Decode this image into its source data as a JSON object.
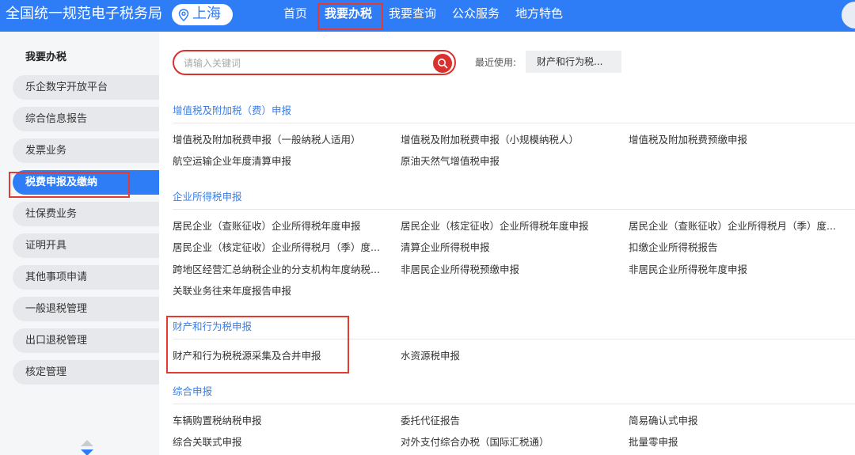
{
  "header": {
    "brand": "全国统一规范电子税务局",
    "region": "上海",
    "nav": [
      "首页",
      "我要办税",
      "我要查询",
      "公众服务",
      "地方特色"
    ]
  },
  "sidebar": {
    "title": "我要办税",
    "items": [
      "乐企数字开放平台",
      "综合信息报告",
      "发票业务",
      "税费申报及缴纳",
      "社保费业务",
      "证明开具",
      "其他事项申请",
      "一般退税管理",
      "出口退税管理",
      "核定管理"
    ],
    "active": "税费申报及缴纳"
  },
  "search": {
    "placeholder": "请输入关键词",
    "recent_label": "最近使用:",
    "recent_item": "财产和行为税..."
  },
  "sections": [
    {
      "title": "增值税及附加税（费）申报",
      "items": [
        "增值税及附加税费申报（一般纳税人适用）",
        "增值税及附加税费申报（小规模纳税人）",
        "增值税及附加税费预缴申报",
        "航空运输企业年度清算申报",
        "原油天然气增值税申报"
      ]
    },
    {
      "title": "企业所得税申报",
      "items": [
        "居民企业（查账征收）企业所得税年度申报",
        "居民企业（核定征收）企业所得税年度申报",
        "居民企业（查账征收）企业所得税月（季）度...",
        "居民企业（核定征收）企业所得税月（季）度...",
        "清算企业所得税申报",
        "扣缴企业所得税报告",
        "跨地区经营汇总纳税企业的分支机构年度纳税...",
        "非居民企业所得税预缴申报",
        "非居民企业所得税年度申报",
        "关联业务往来年度报告申报"
      ]
    },
    {
      "title": "财产和行为税申报",
      "items": [
        "财产和行为税税源采集及合并申报",
        "水资源税申报"
      ]
    },
    {
      "title": "综合申报",
      "items": [
        "车辆购置税纳税申报",
        "委托代征报告",
        "简易确认式申报",
        "综合关联式申报",
        "对外支付综合办税（国际汇税通）",
        "批量零申报"
      ]
    }
  ],
  "colors": {
    "primary": "#2f7df6",
    "highlight": "#e53a2e",
    "section_title": "#3a7ee6"
  }
}
